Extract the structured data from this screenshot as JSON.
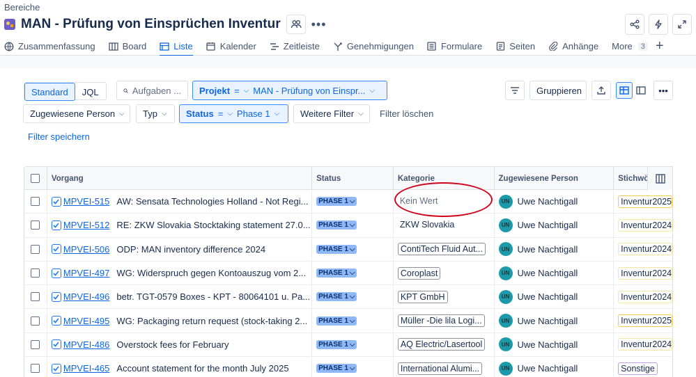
{
  "breadcrumb": "Bereiche",
  "project": {
    "title": "MAN - Prüfung von Einsprüchen Inventur"
  },
  "tabs": [
    {
      "label": "Zusammenfassung",
      "icon": "globe-icon"
    },
    {
      "label": "Board",
      "icon": "board-icon"
    },
    {
      "label": "Liste",
      "icon": "list-icon",
      "active": true
    },
    {
      "label": "Kalender",
      "icon": "calendar-icon"
    },
    {
      "label": "Zeitleiste",
      "icon": "timeline-icon"
    },
    {
      "label": "Genehmigungen",
      "icon": "approvals-icon"
    },
    {
      "label": "Formulare",
      "icon": "forms-icon"
    },
    {
      "label": "Seiten",
      "icon": "pages-icon"
    },
    {
      "label": "Anhänge",
      "icon": "paperclip-icon"
    }
  ],
  "more": {
    "label": "More",
    "count": "3"
  },
  "toolbar": {
    "standard": "Standard",
    "jql": "JQL",
    "search_placeholder": "Aufgaben ...",
    "project_field": "Projekt",
    "project_op": "=",
    "project_value": "MAN - Prüfung von Einspr...",
    "group_by": "Gruppieren"
  },
  "filters": {
    "assignee": "Zugewiesene Person",
    "type": "Typ",
    "status_field": "Status",
    "status_op": "=",
    "status_value": "Phase 1",
    "more_filters": "Weitere Filter",
    "clear": "Filter löschen",
    "save": "Filter speichern"
  },
  "columns": {
    "vorgang": "Vorgang",
    "status": "Status",
    "kategorie": "Kategorie",
    "assignee": "Zugewiesene Person",
    "labels": "Stichwö"
  },
  "rows": [
    {
      "key": "MPVEI-515",
      "summary": "AW: Sensata Technologies Holland - Not Regi...",
      "status": "PHASE 1",
      "category": "Kein Wert",
      "assignee_initials": "UN",
      "assignee": "Uwe Nachtigall",
      "label": "Inventur2025"
    },
    {
      "key": "MPVEI-512",
      "summary": "RE: ZKW Slovakia Stocktaking statement 27.0...",
      "status": "PHASE 1",
      "category": "ZKW Slovakia",
      "assignee_initials": "UN",
      "assignee": "Uwe Nachtigall",
      "label": "Inventur2024"
    },
    {
      "key": "MPVEI-506",
      "summary": "ODP: MAN inventory difference 2024",
      "status": "PHASE 1",
      "category": "ContiTech Fluid Aut...",
      "assignee_initials": "UN",
      "assignee": "Uwe Nachtigall",
      "label": "Inventur2024"
    },
    {
      "key": "MPVEI-497",
      "summary": "WG: Widerspruch gegen Kontoauszug vom 2...",
      "status": "PHASE 1",
      "category": "Coroplast",
      "assignee_initials": "UN",
      "assignee": "Uwe Nachtigall",
      "label": "Inventur2024"
    },
    {
      "key": "MPVEI-496",
      "summary": "betr. TGT-0579 Boxes - KPT - 80064101 u. Pa...",
      "status": "PHASE 1",
      "category": "KPT GmbH",
      "assignee_initials": "UN",
      "assignee": "Uwe Nachtigall",
      "label": "Inventur2024"
    },
    {
      "key": "MPVEI-495",
      "summary": "WG: Packaging return request (stock-taking 2...",
      "status": "PHASE 1",
      "category": "Müller -Die lila Logi...",
      "assignee_initials": "UN",
      "assignee": "Uwe Nachtigall",
      "label": "Inventur2025"
    },
    {
      "key": "MPVEI-486",
      "summary": "Overstock fees for February",
      "status": "PHASE 1",
      "category": "AQ Electric/Lasertool",
      "assignee_initials": "UN",
      "assignee": "Uwe Nachtigall",
      "label": "Inventur2024"
    },
    {
      "key": "MPVEI-465",
      "summary": "Account statement for the month July 2025",
      "status": "PHASE 1",
      "category": "International Alumi...",
      "assignee_initials": "UN",
      "assignee": "Uwe Nachtigall",
      "label": "Sonstige"
    }
  ]
}
